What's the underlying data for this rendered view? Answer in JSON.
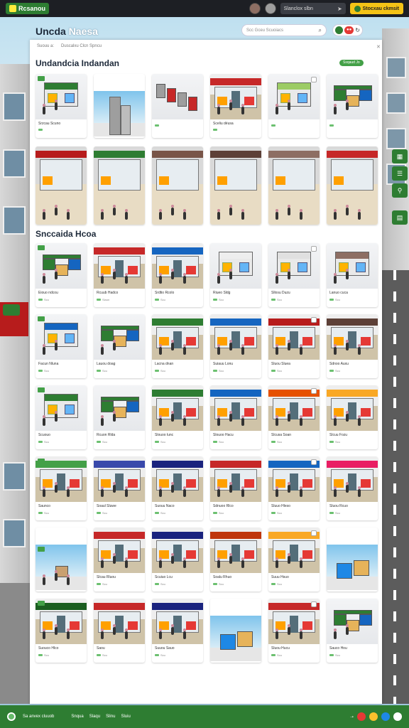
{
  "topbar": {
    "logo_text": "Rcsanou",
    "search_text": "Slanclox slbn",
    "cta_label": "Stocxau ckmsit"
  },
  "header": {
    "title_part1": "Uncda",
    "title_part2": "Naesa",
    "search_placeholder": "Scc Gceu Scuoiacs"
  },
  "panel": {
    "breadcrumbs": [
      "Suouu a:",
      "Duscalxu Clcn Spncu"
    ],
    "section1_title": "Undandcia Indandan",
    "section1_pill": "Ssqaud Jo",
    "section2_title": "Snccaida Hcoa"
  },
  "section1": {
    "row1": [
      {
        "name": "Srzcau Scuno",
        "meta": "",
        "style": "store",
        "sign": "#2e7d32"
      },
      {
        "name": "",
        "meta": "",
        "style": "towers",
        "sign": ""
      },
      {
        "name": "",
        "meta": "",
        "style": "stalls",
        "sign": "#c62828"
      },
      {
        "name": "Sceliu déusa",
        "meta": "",
        "style": "front",
        "sign": "#c62828"
      },
      {
        "name": "",
        "meta": "",
        "style": "store",
        "sign": "#9ccc65"
      },
      {
        "name": "",
        "meta": "",
        "style": "boxes",
        "sign": "#2e7d32"
      }
    ],
    "row2": [
      {
        "style": "mall",
        "sign": "#b71c1c"
      },
      {
        "style": "mall",
        "sign": "#2e7d32"
      },
      {
        "style": "mall",
        "sign": "#795548"
      },
      {
        "style": "mall",
        "sign": "#5d4037"
      },
      {
        "style": "mall",
        "sign": "#8d6e63"
      },
      {
        "style": "mall",
        "sign": "#c62828"
      }
    ]
  },
  "section2": [
    [
      {
        "name": "Eiouo ndcou",
        "meta": "Scu",
        "style": "boxes",
        "sign": "#2e7d32"
      },
      {
        "name": "Rcuub Hadco",
        "meta": "Slaun",
        "style": "front",
        "sign": "#c62828"
      },
      {
        "name": "Srdtio Rcolo",
        "meta": "Scu",
        "style": "front",
        "sign": "#1565c0"
      },
      {
        "name": "Riueo Sldg",
        "meta": "Scu",
        "style": "store",
        "sign": "#eeeeee"
      },
      {
        "name": "Sllosu Duzu",
        "meta": "Scu",
        "style": "store",
        "sign": "#e0e0e0"
      },
      {
        "name": "Lanuo cuca",
        "meta": "Scu",
        "style": "store",
        "sign": "#8d6e63"
      }
    ],
    [
      {
        "name": "Facun Nluna",
        "meta": "Scu",
        "style": "store",
        "sign": "#1565c0"
      },
      {
        "name": "Lauou doag",
        "meta": "Scu",
        "style": "boxes",
        "sign": "#2e7d32"
      },
      {
        "name": "Lacna dnan",
        "meta": "Scu",
        "style": "front",
        "sign": "#2e7d32"
      },
      {
        "name": "Suiauu Lonu",
        "meta": "Scu",
        "style": "front",
        "sign": "#1565c0"
      },
      {
        "name": "Sluou Sluea",
        "meta": "Scu",
        "style": "front",
        "sign": "#b71c1c"
      },
      {
        "name": "Sdnoo Auxu",
        "meta": "Scu",
        "style": "front",
        "sign": "#5d4037"
      }
    ],
    [
      {
        "name": "Scuouo",
        "meta": "Scu",
        "style": "store",
        "sign": "#2e7d32"
      },
      {
        "name": "Rcuon Rlda",
        "meta": "Scu",
        "style": "boxes",
        "sign": "#2e7d32"
      },
      {
        "name": "Slouoo lunc",
        "meta": "Scu",
        "style": "front",
        "sign": "#2e7d32"
      },
      {
        "name": "Slouoo Hacu",
        "meta": "Scu",
        "style": "front",
        "sign": "#1565c0"
      },
      {
        "name": "Slcusa Soan",
        "meta": "Scu",
        "style": "front",
        "sign": "#e65100"
      },
      {
        "name": "Slcuu Fozu",
        "meta": "Scu",
        "style": "front",
        "sign": "#f9a825"
      }
    ],
    [
      {
        "name": "Saunco",
        "meta": "Scu",
        "style": "front",
        "sign": "#43a047"
      },
      {
        "name": "Soaul Sluwe",
        "meta": "Scu",
        "style": "front",
        "sign": "#3949ab"
      },
      {
        "name": "Suouu Naco",
        "meta": "Scu",
        "style": "front",
        "sign": "#1a237e"
      },
      {
        "name": "Sdnuoo Rlco",
        "meta": "Scu",
        "style": "front",
        "sign": "#c62828"
      },
      {
        "name": "Sluuo Hleso",
        "meta": "Scu",
        "style": "front",
        "sign": "#1565c0"
      },
      {
        "name": "Sluou Rcuo",
        "meta": "Scu",
        "style": "front",
        "sign": "#e91e63"
      }
    ],
    [
      {
        "name": "Suuo Lwaou",
        "meta": "Scu",
        "style": "sky",
        "sign": ""
      },
      {
        "name": "Slcau Rluou",
        "meta": "Scu",
        "style": "front",
        "sign": "#c62828"
      },
      {
        "name": "Scuiuo Lcu",
        "meta": "Scu",
        "style": "front",
        "sign": "#1a237e"
      },
      {
        "name": "Soalu Rhuo",
        "meta": "Scu",
        "style": "front",
        "sign": "#bf360c"
      },
      {
        "name": "Suuu Hsuo",
        "meta": "Scu",
        "style": "front",
        "sign": "#f9a825"
      },
      {
        "name": "Suuso Rcuo",
        "meta": "Scu",
        "style": "skybox",
        "sign": ""
      }
    ],
    [
      {
        "name": "Suouco Hlco",
        "meta": "Scu",
        "style": "front",
        "sign": "#1b5e20"
      },
      {
        "name": "Saou",
        "meta": "Scu",
        "style": "front",
        "sign": "#c62828"
      },
      {
        "name": "Suuou Sauo",
        "meta": "Scu",
        "style": "front",
        "sign": "#1a237e"
      },
      {
        "name": "",
        "meta": "",
        "style": "skybox",
        "sign": ""
      },
      {
        "name": "Sluou Hucu",
        "meta": "Scu",
        "style": "front",
        "sign": "#c62828"
      },
      {
        "name": "Sauco Hou",
        "meta": "Scu",
        "style": "boxes",
        "sign": "#2e7d32"
      }
    ]
  ],
  "footer": {
    "brand": "Sa anvex cluuob",
    "links": [
      "Snqua",
      "Slaqu",
      "Slinu",
      "Sluiu"
    ]
  },
  "colors": {
    "accent_green": "#2e7d32",
    "topbar_dark": "#1d1f24",
    "cta_yellow": "#f4c316"
  }
}
